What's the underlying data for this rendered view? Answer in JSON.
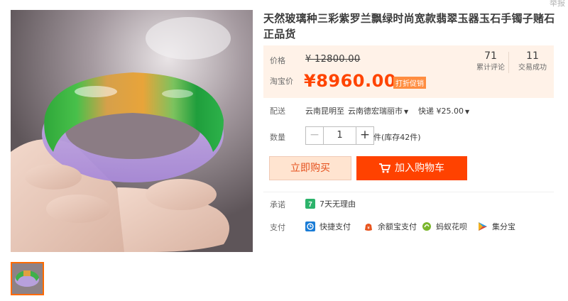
{
  "header": {
    "report_label": "举报"
  },
  "product": {
    "title": "天然玻璃种三彩紫罗兰飘绿时尚宽款翡翠玉器玉石手镯子赌石正品货"
  },
  "price": {
    "orig_label": "价格",
    "orig_value": "¥ 12800.00",
    "promo_label": "淘宝价",
    "promo_value": "¥8960.00",
    "promo_tag": "打折促销"
  },
  "stats": {
    "reviews_count": "71",
    "reviews_label": "累计评论",
    "sales_count": "11",
    "sales_label": "交易成功"
  },
  "shipping": {
    "label": "配送",
    "from": "云南昆明",
    "to_word": "至",
    "destination": "云南德宏瑞丽市",
    "method": "快递 ¥25.00"
  },
  "quantity": {
    "label": "数量",
    "value": "1",
    "minus": "−",
    "plus": "+",
    "stock": "件(库存42件)"
  },
  "actions": {
    "buy_now": "立即购买",
    "add_cart": "加入购物车"
  },
  "promise": {
    "label": "承诺",
    "text": "7天无理由"
  },
  "payment": {
    "label": "支付",
    "methods": [
      {
        "icon": "quick-pay-icon",
        "label": "快捷支付",
        "color": "#1a7cd6"
      },
      {
        "icon": "yuebao-icon",
        "label": "余额宝支付",
        "color": "#e8541e"
      },
      {
        "icon": "huabei-icon",
        "label": "蚂蚁花呗",
        "color": "#7ab62c"
      },
      {
        "icon": "jifenbao-icon",
        "label": "集分宝",
        "color": "#2f9bdc"
      }
    ]
  },
  "colors": {
    "accent": "#ff4400",
    "price_bg": "#fff2e8",
    "cart_button": "#ff4200",
    "buy_button_bg": "#ffe4d0"
  }
}
